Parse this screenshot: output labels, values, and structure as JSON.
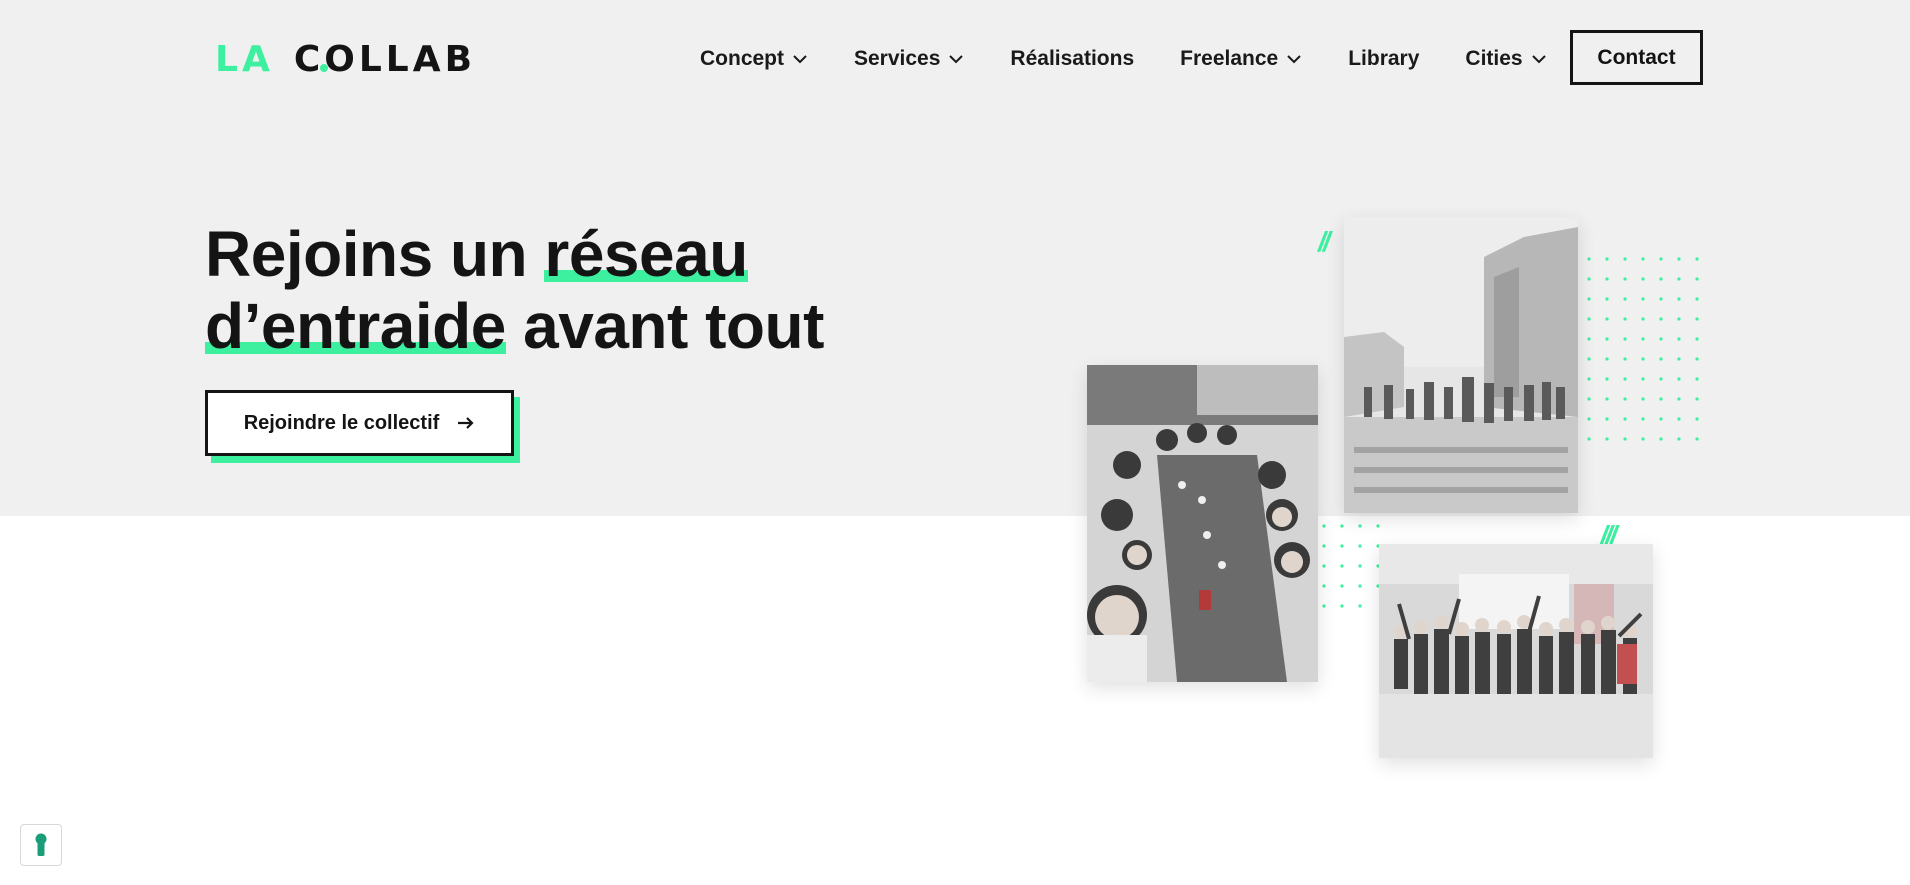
{
  "brand": {
    "logo_left": "LA",
    "logo_right": "COLLAB",
    "accent_color": "#3cf0a0",
    "text_color": "#141414"
  },
  "nav": {
    "items": [
      {
        "label": "Concept",
        "has_dropdown": true
      },
      {
        "label": "Services",
        "has_dropdown": true
      },
      {
        "label": "Réalisations",
        "has_dropdown": false
      },
      {
        "label": "Freelance",
        "has_dropdown": true
      },
      {
        "label": "Library",
        "has_dropdown": false
      },
      {
        "label": "Cities",
        "has_dropdown": true
      }
    ],
    "contact_label": "Contact"
  },
  "hero": {
    "line1_pre": "Rejoins un ",
    "line1_highlight": "réseau",
    "line2_highlight": "d’entraide",
    "line2_post": " avant tout",
    "cta_label": "Rejoindre le collectif",
    "cta_icon": "arrow-right-icon"
  },
  "photos": [
    {
      "name": "group-terrace-photo"
    },
    {
      "name": "street-walk-photo"
    },
    {
      "name": "team-celebration-photo"
    }
  ],
  "cookie": {
    "icon": "keyhole-icon"
  }
}
